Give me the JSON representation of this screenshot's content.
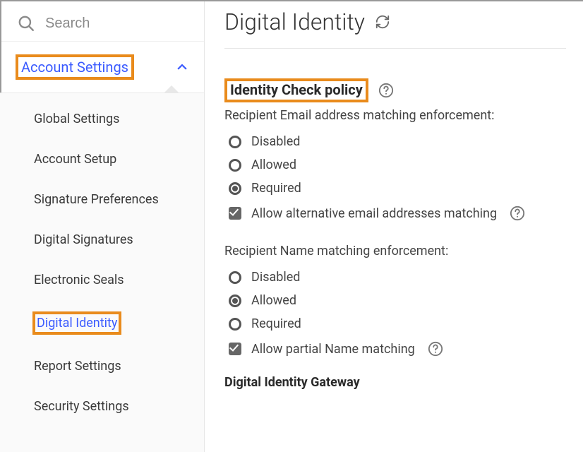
{
  "sidebar": {
    "search_placeholder": "Search",
    "section_label": "Account Settings",
    "items": [
      {
        "label": "Global Settings",
        "active": false
      },
      {
        "label": "Account Setup",
        "active": false
      },
      {
        "label": "Signature Preferences",
        "active": false
      },
      {
        "label": "Digital Signatures",
        "active": false
      },
      {
        "label": "Electronic Seals",
        "active": false
      },
      {
        "label": "Digital Identity",
        "active": true
      },
      {
        "label": "Report Settings",
        "active": false
      },
      {
        "label": "Security Settings",
        "active": false
      }
    ]
  },
  "main": {
    "title": "Digital Identity",
    "section_title": "Identity Check policy",
    "email_block": {
      "label": "Recipient Email address matching enforcement:",
      "options": [
        "Disabled",
        "Allowed",
        "Required"
      ],
      "selected": "Required",
      "checkbox_label": "Allow alternative email addresses matching",
      "checkbox_checked": true
    },
    "name_block": {
      "label": "Recipient Name matching enforcement:",
      "options": [
        "Disabled",
        "Allowed",
        "Required"
      ],
      "selected": "Allowed",
      "checkbox_label": "Allow partial Name matching",
      "checkbox_checked": true
    },
    "gateway_title": "Digital Identity Gateway"
  },
  "highlights": {
    "color": "#e98b1c"
  }
}
